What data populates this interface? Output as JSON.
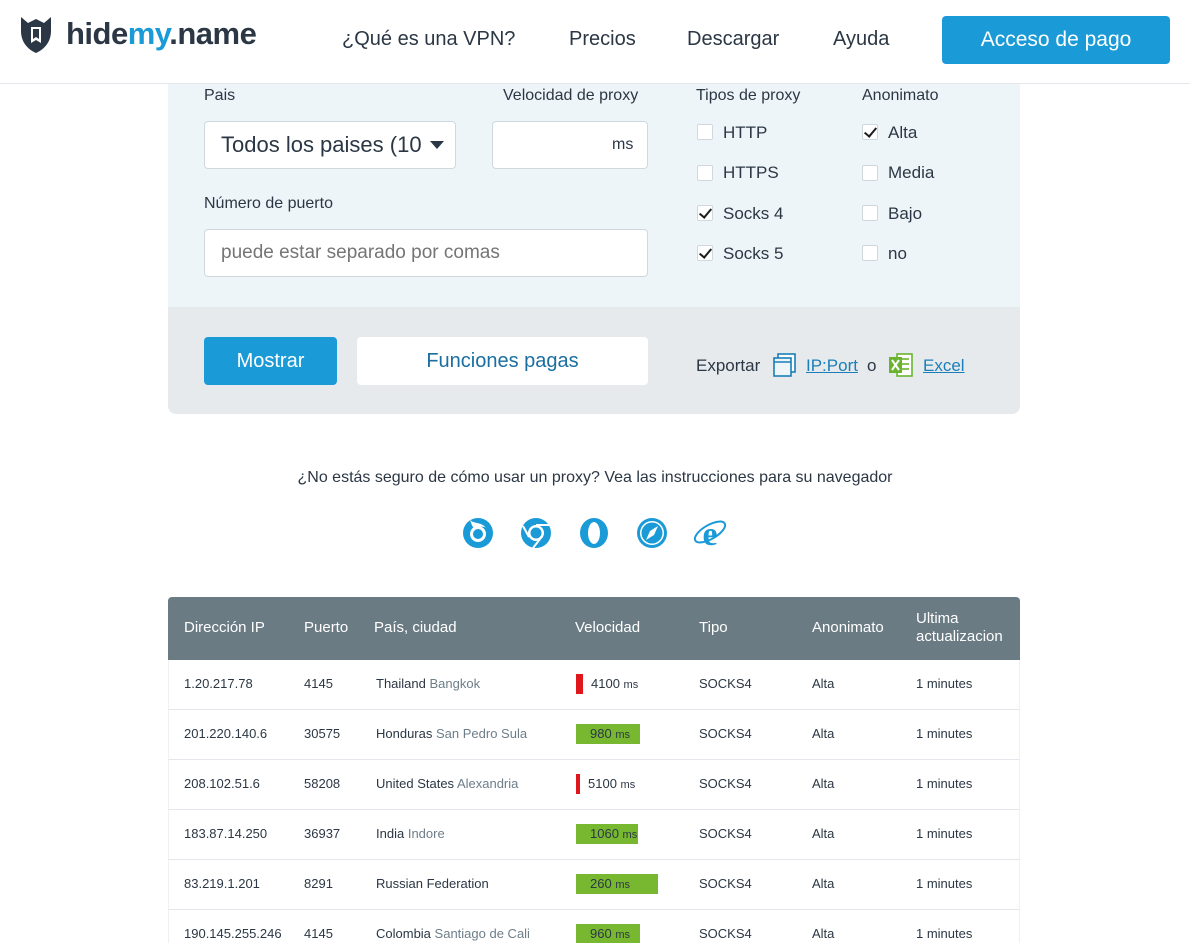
{
  "brand": {
    "logo_main": "hide",
    "logo_accent": "my",
    "logo_suffix": ".name",
    "accent_color": "#1a9ad6",
    "header_text_color": "#2b3744"
  },
  "nav": {
    "items": [
      "¿Qué es una VPN?",
      "Precios",
      "Descargar",
      "Ayuda"
    ],
    "cta": "Acceso de pago"
  },
  "filters": {
    "country_label": "Pais",
    "country_value": "Todos los paises (10",
    "speed_label": "Velocidad de proxy",
    "speed_value": "",
    "speed_unit": "ms",
    "port_label": "Número de puerto",
    "port_placeholder": "puede estar separado por comas",
    "types_label": "Tipos de proxy",
    "types": [
      {
        "label": "HTTP",
        "checked": false
      },
      {
        "label": "HTTPS",
        "checked": false
      },
      {
        "label": "Socks 4",
        "checked": true
      },
      {
        "label": "Socks 5",
        "checked": true
      }
    ],
    "anon_label": "Anonimato",
    "anon": [
      {
        "label": "Alta",
        "checked": true
      },
      {
        "label": "Media",
        "checked": false
      },
      {
        "label": "Bajo",
        "checked": false
      },
      {
        "label": "no",
        "checked": false
      }
    ]
  },
  "actions": {
    "show": "Mostrar",
    "paid": "Funciones pagas",
    "export_label": "Exportar",
    "export_ipport": "IP:Port",
    "export_or": "o",
    "export_excel": "Excel"
  },
  "instructions": {
    "text": "¿No estás seguro de cómo usar un proxy? Vea las instrucciones para su navegador",
    "browsers": [
      "firefox-icon",
      "chrome-icon",
      "opera-icon",
      "safari-icon",
      "ie-icon"
    ]
  },
  "table": {
    "headers": {
      "ip": "Dirección IP",
      "port": "Puerto",
      "location": "País, ciudad",
      "speed": "Velocidad",
      "type": "Tipo",
      "anon": "Anonimato",
      "updated_1": "Ultima",
      "updated_2": "actualizacion"
    },
    "speed_colors": {
      "slow": "#e0161d",
      "fast": "#78b830"
    },
    "rows": [
      {
        "ip": "1.20.217.78",
        "port": "4145",
        "country": "Thailand",
        "city": "Bangkok",
        "speed": "4100",
        "unit": "ms",
        "speed_fill": 0.08,
        "status": "slow",
        "type": "SOCKS4",
        "anon": "Alta",
        "updated": "1 minutes"
      },
      {
        "ip": "201.220.140.6",
        "port": "30575",
        "country": "Honduras",
        "city": "San Pedro Sula",
        "speed": "980",
        "unit": "ms",
        "speed_fill": 0.78,
        "status": "fast",
        "type": "SOCKS4",
        "anon": "Alta",
        "updated": "1 minutes"
      },
      {
        "ip": "208.102.51.6",
        "port": "58208",
        "country": "United States",
        "city": "Alexandria",
        "speed": "5100",
        "unit": "ms",
        "speed_fill": 0.03,
        "status": "slow",
        "type": "SOCKS4",
        "anon": "Alta",
        "updated": "1 minutes"
      },
      {
        "ip": "183.87.14.250",
        "port": "36937",
        "country": "India",
        "city": "Indore",
        "speed": "1060",
        "unit": "ms",
        "speed_fill": 0.76,
        "status": "fast",
        "type": "SOCKS4",
        "anon": "Alta",
        "updated": "1 minutes"
      },
      {
        "ip": "83.219.1.201",
        "port": "8291",
        "country": "Russian Federation",
        "city": "",
        "speed": "260",
        "unit": "ms",
        "speed_fill": 1.0,
        "status": "fast",
        "type": "SOCKS4",
        "anon": "Alta",
        "updated": "1 minutes"
      },
      {
        "ip": "190.145.255.246",
        "port": "4145",
        "country": "Colombia",
        "city": "Santiago de Cali",
        "speed": "960",
        "unit": "ms",
        "speed_fill": 0.78,
        "status": "fast",
        "type": "SOCKS4",
        "anon": "Alta",
        "updated": "1 minutes"
      }
    ]
  }
}
